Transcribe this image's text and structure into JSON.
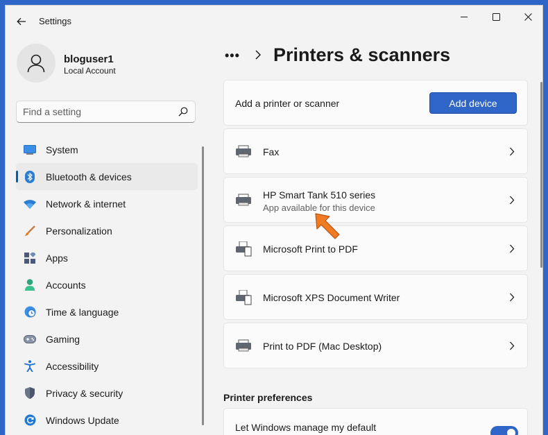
{
  "window": {
    "title": "Settings"
  },
  "user": {
    "name": "bloguser1",
    "account_type": "Local Account"
  },
  "search": {
    "placeholder": "Find a setting"
  },
  "sidebar": {
    "items": [
      {
        "label": "System",
        "icon": "monitor-icon",
        "active": false
      },
      {
        "label": "Bluetooth & devices",
        "icon": "bluetooth-icon",
        "active": true
      },
      {
        "label": "Network & internet",
        "icon": "wifi-icon",
        "active": false
      },
      {
        "label": "Personalization",
        "icon": "brush-icon",
        "active": false
      },
      {
        "label": "Apps",
        "icon": "apps-icon",
        "active": false
      },
      {
        "label": "Accounts",
        "icon": "person-icon",
        "active": false
      },
      {
        "label": "Time & language",
        "icon": "globe-clock-icon",
        "active": false
      },
      {
        "label": "Gaming",
        "icon": "gamepad-icon",
        "active": false
      },
      {
        "label": "Accessibility",
        "icon": "accessibility-icon",
        "active": false
      },
      {
        "label": "Privacy & security",
        "icon": "shield-icon",
        "active": false
      },
      {
        "label": "Windows Update",
        "icon": "update-icon",
        "active": false
      }
    ]
  },
  "header": {
    "breadcrumb_more": "•••",
    "title": "Printers & scanners"
  },
  "add_card": {
    "label": "Add a printer or scanner",
    "button": "Add device"
  },
  "devices": [
    {
      "name": "Fax",
      "subtitle": ""
    },
    {
      "name": "HP Smart Tank 510 series",
      "subtitle": "App available for this device"
    },
    {
      "name": "Microsoft Print to PDF",
      "subtitle": ""
    },
    {
      "name": "Microsoft XPS Document Writer",
      "subtitle": ""
    },
    {
      "name": "Print to PDF (Mac Desktop)",
      "subtitle": ""
    }
  ],
  "preferences": {
    "title": "Printer preferences",
    "default_label": "Let Windows manage my default",
    "default_toggle_on": true
  },
  "colors": {
    "accent": "#2f65c6",
    "indicator": "#005fb8",
    "annotation_arrow": "#f07b22"
  }
}
